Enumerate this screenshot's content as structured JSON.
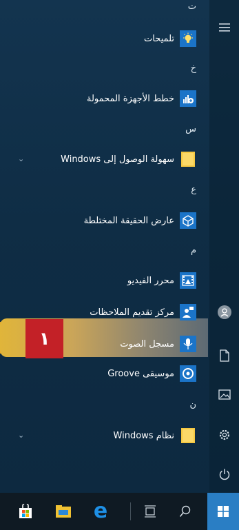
{
  "colors": {
    "tile": "#1b74c8",
    "highlight": "#d9b14a",
    "badge": "#c32127"
  },
  "badge": "١",
  "sections": [
    {
      "letter": "ت",
      "apps": [
        {
          "label": "تلميحات",
          "icon": "lightbulb-icon"
        }
      ]
    },
    {
      "letter": "خ",
      "apps": [
        {
          "label": "خطط الأجهزة المحمولة",
          "icon": "mobile-plans-icon"
        }
      ]
    },
    {
      "letter": "س",
      "apps": [
        {
          "label": "سهولة الوصول إلى Windows",
          "icon": "folder-icon",
          "expandable": true
        }
      ]
    },
    {
      "letter": "ع",
      "apps": [
        {
          "label": "عارض الحقيقة المختلطة",
          "icon": "cube-icon"
        }
      ]
    },
    {
      "letter": "م",
      "apps": [
        {
          "label": "محرر الفيديو",
          "icon": "video-editor-icon"
        },
        {
          "label": "مركز تقديم الملاحظات",
          "icon": "feedback-hub-icon"
        },
        {
          "label": "مسجل الصوت",
          "icon": "voice-recorder-icon",
          "highlighted": true
        },
        {
          "label": "موسيقى Groove",
          "icon": "groove-music-icon"
        }
      ]
    },
    {
      "letter": "ن",
      "apps": [
        {
          "label": "نظام Windows",
          "icon": "folder-icon",
          "expandable": true
        }
      ]
    }
  ],
  "rail": [
    "hamburger-icon",
    "user-avatar-icon",
    "documents-icon",
    "pictures-icon",
    "settings-icon",
    "power-icon"
  ],
  "taskbar": [
    "store-icon",
    "file-explorer-icon",
    "edge-icon",
    "task-view-icon",
    "search-icon",
    "start-icon"
  ]
}
